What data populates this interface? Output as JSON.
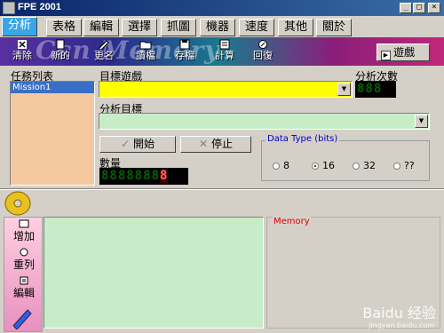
{
  "window": {
    "title": "FPE 2001",
    "min": "_",
    "max": "□",
    "close": "×"
  },
  "tabs": [
    {
      "label": "分析",
      "active": true
    },
    {
      "label": "表格"
    },
    {
      "label": "編輯"
    },
    {
      "label": "選擇"
    },
    {
      "label": "抓圖"
    },
    {
      "label": "機器"
    },
    {
      "label": "速度"
    },
    {
      "label": "其他"
    },
    {
      "label": "關於"
    }
  ],
  "toolbar": {
    "watermark": "Ccn Memory",
    "items": [
      {
        "label": "清除",
        "icon": "clear-icon"
      },
      {
        "label": "新的",
        "icon": "new-icon"
      },
      {
        "label": "更名",
        "icon": "rename-icon"
      },
      {
        "label": "讀檔",
        "icon": "load-icon"
      },
      {
        "label": "存檔",
        "icon": "save-icon"
      },
      {
        "label": "計算",
        "icon": "calc-icon"
      },
      {
        "label": "回復",
        "icon": "restore-icon"
      }
    ],
    "game_button": "遊戲"
  },
  "task_list": {
    "label": "任務列表",
    "items": [
      "Mission1"
    ]
  },
  "target_game": {
    "label": "目標遊戲",
    "value": ""
  },
  "analysis_count": {
    "label": "分析次數",
    "value": "888"
  },
  "analysis_target": {
    "label": "分析目標",
    "value": ""
  },
  "buttons": {
    "start": "開始",
    "stop": "停止"
  },
  "quantity": {
    "label": "數量",
    "digits": "8888888",
    "last_digit": "8"
  },
  "data_type": {
    "legend": "Data Type (bits)",
    "options": [
      {
        "label": "8",
        "selected": false
      },
      {
        "label": "16",
        "selected": true
      },
      {
        "label": "32",
        "selected": false
      },
      {
        "label": "??",
        "selected": false
      }
    ]
  },
  "sidebar": {
    "items": [
      {
        "label": "增加"
      },
      {
        "label": "重列"
      },
      {
        "label": "編輯"
      }
    ]
  },
  "memory": {
    "legend": "Memory"
  },
  "watermark": {
    "main": "Baidu 经验",
    "sub": "jingyan.baidu.com"
  },
  "colors": {
    "tab_active": "#3aa6e8",
    "game_combo": "#ffff00",
    "target_combo": "#c8ecc8",
    "task_list": "#f4c8a0"
  }
}
